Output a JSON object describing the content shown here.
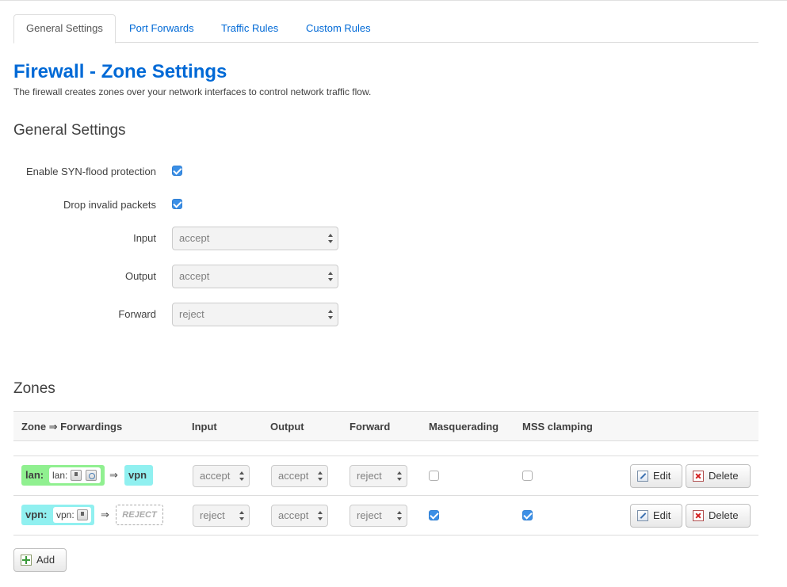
{
  "tabs": [
    {
      "label": "General Settings",
      "active": true
    },
    {
      "label": "Port Forwards",
      "active": false
    },
    {
      "label": "Traffic Rules",
      "active": false
    },
    {
      "label": "Custom Rules",
      "active": false
    }
  ],
  "page": {
    "title": "Firewall - Zone Settings",
    "description": "The firewall creates zones over your network interfaces to control network traffic flow."
  },
  "general": {
    "heading": "General Settings",
    "syn_flood": {
      "label": "Enable SYN-flood protection",
      "checked": true
    },
    "drop_invalid": {
      "label": "Drop invalid packets",
      "checked": true
    },
    "input": {
      "label": "Input",
      "value": "accept"
    },
    "output": {
      "label": "Output",
      "value": "accept"
    },
    "forward": {
      "label": "Forward",
      "value": "reject"
    }
  },
  "zones": {
    "heading": "Zones",
    "headers": {
      "zone": "Zone ⇒ Forwardings",
      "input": "Input",
      "output": "Output",
      "forward": "Forward",
      "masq": "Masquerading",
      "mss": "MSS clamping"
    },
    "rows": [
      {
        "zone": "lan:",
        "inner": "lan:",
        "arrow": "⇒",
        "dest": "vpn",
        "input": "accept",
        "output": "accept",
        "forward": "reject",
        "masquerading": false,
        "mss_clamping": false,
        "edit": "Edit",
        "delete": "Delete",
        "color": "#90f090"
      },
      {
        "zone": "vpn:",
        "inner": "vpn:",
        "arrow": "⇒",
        "dest": "REJECT",
        "input": "reject",
        "output": "accept",
        "forward": "reject",
        "masquerading": true,
        "mss_clamping": true,
        "edit": "Edit",
        "delete": "Delete",
        "color": "#90f0f0"
      }
    ],
    "add_label": "Add"
  },
  "colors": {
    "accent": "#0069d6",
    "lan_zone": "#90f090",
    "vpn_zone": "#90f0f0",
    "checkbox": "#3b8fe6"
  }
}
